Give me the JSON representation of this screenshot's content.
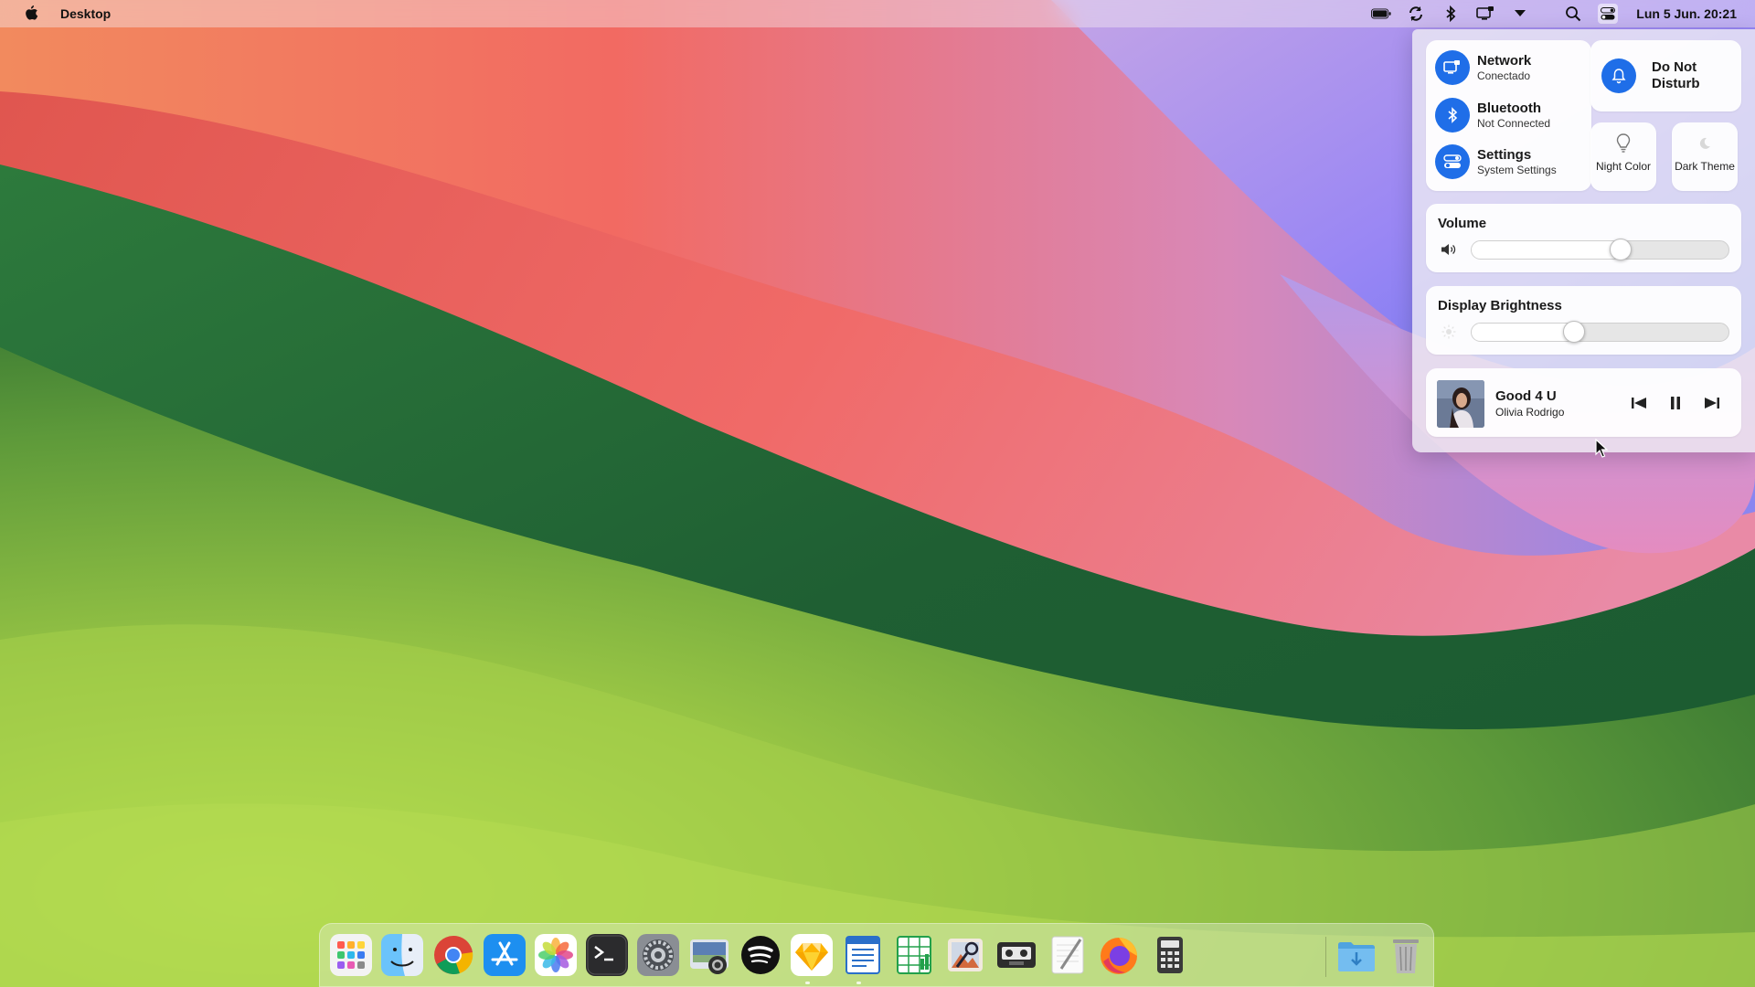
{
  "menubar": {
    "app_name": "Desktop",
    "icons": [
      "apple-logo-icon",
      "battery-icon",
      "sync-icon",
      "bluetooth-icon",
      "display-icon",
      "dropdown-triangle-icon",
      "search-icon",
      "control-center-icon"
    ],
    "clock": "Lun 5 Jun. 20:21"
  },
  "control_center": {
    "network": {
      "title": "Network",
      "status": "Conectado",
      "icon": "network-icon"
    },
    "bluetooth": {
      "title": "Bluetooth",
      "status": "Not Connected",
      "icon": "bluetooth-icon"
    },
    "settings": {
      "title": "Settings",
      "status": "System Settings",
      "icon": "toggles-icon"
    },
    "do_not_disturb": {
      "label": "Do Not Disturb",
      "icon": "bell-icon"
    },
    "night_color": {
      "label": "Night Color",
      "icon": "lightbulb-icon"
    },
    "dark_theme": {
      "label": "Dark Theme",
      "icon": "moon-icon"
    },
    "volume": {
      "title": "Volume",
      "level": 0.58,
      "icon": "speaker-icon"
    },
    "brightness": {
      "title": "Display Brightness",
      "level": 0.4,
      "icon": "sun-icon"
    },
    "media": {
      "song": "Good 4 U",
      "artist": "Olivia Rodrigo",
      "controls": [
        "previous-icon",
        "pause-icon",
        "next-icon"
      ]
    }
  },
  "dock": {
    "apps": [
      {
        "name": "Launchpad",
        "icon": "launchpad-icon"
      },
      {
        "name": "Finder",
        "icon": "finder-icon"
      },
      {
        "name": "Chrome",
        "icon": "chrome-icon"
      },
      {
        "name": "App Store",
        "icon": "app-store-icon"
      },
      {
        "name": "Photos",
        "icon": "photos-icon"
      },
      {
        "name": "Terminal",
        "icon": "terminal-icon"
      },
      {
        "name": "System Settings",
        "icon": "settings-gear-icon"
      },
      {
        "name": "Screenshot",
        "icon": "screenshot-icon"
      },
      {
        "name": "Spotify",
        "icon": "spotify-icon"
      },
      {
        "name": "Sketch",
        "icon": "sketch-icon"
      },
      {
        "name": "Writer",
        "icon": "document-icon"
      },
      {
        "name": "Spreadsheet",
        "icon": "spreadsheet-icon"
      },
      {
        "name": "Preview",
        "icon": "preview-icon"
      },
      {
        "name": "Tape",
        "icon": "cassette-icon"
      },
      {
        "name": "TextEdit",
        "icon": "textedit-icon"
      },
      {
        "name": "Firefox",
        "icon": "firefox-icon"
      },
      {
        "name": "Calculator",
        "icon": "calculator-icon"
      },
      {
        "name": "Downloads",
        "icon": "downloads-folder-icon"
      },
      {
        "name": "Trash",
        "icon": "trash-icon"
      }
    ]
  },
  "colors": {
    "accent": "#1f6ee8"
  }
}
